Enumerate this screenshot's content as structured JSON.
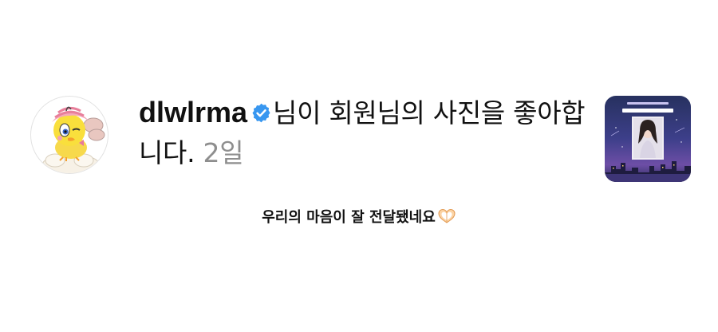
{
  "notification": {
    "username": "dlwlrma",
    "message_before_time": "님이 회원님의 사진을 좋아합니다.",
    "time": "2일",
    "avatar_icon": "tweety-bird-avatar",
    "verified_icon": "verified-badge-icon",
    "thumbnail_icon": "liked-photo-thumbnail",
    "colors": {
      "verified": "#3897f0",
      "time": "#8e8e8e",
      "text": "#111111"
    }
  },
  "caption": {
    "text": "우리의 마음이 잘 전달됐네요",
    "emoji_icon": "heart-hands-icon"
  }
}
